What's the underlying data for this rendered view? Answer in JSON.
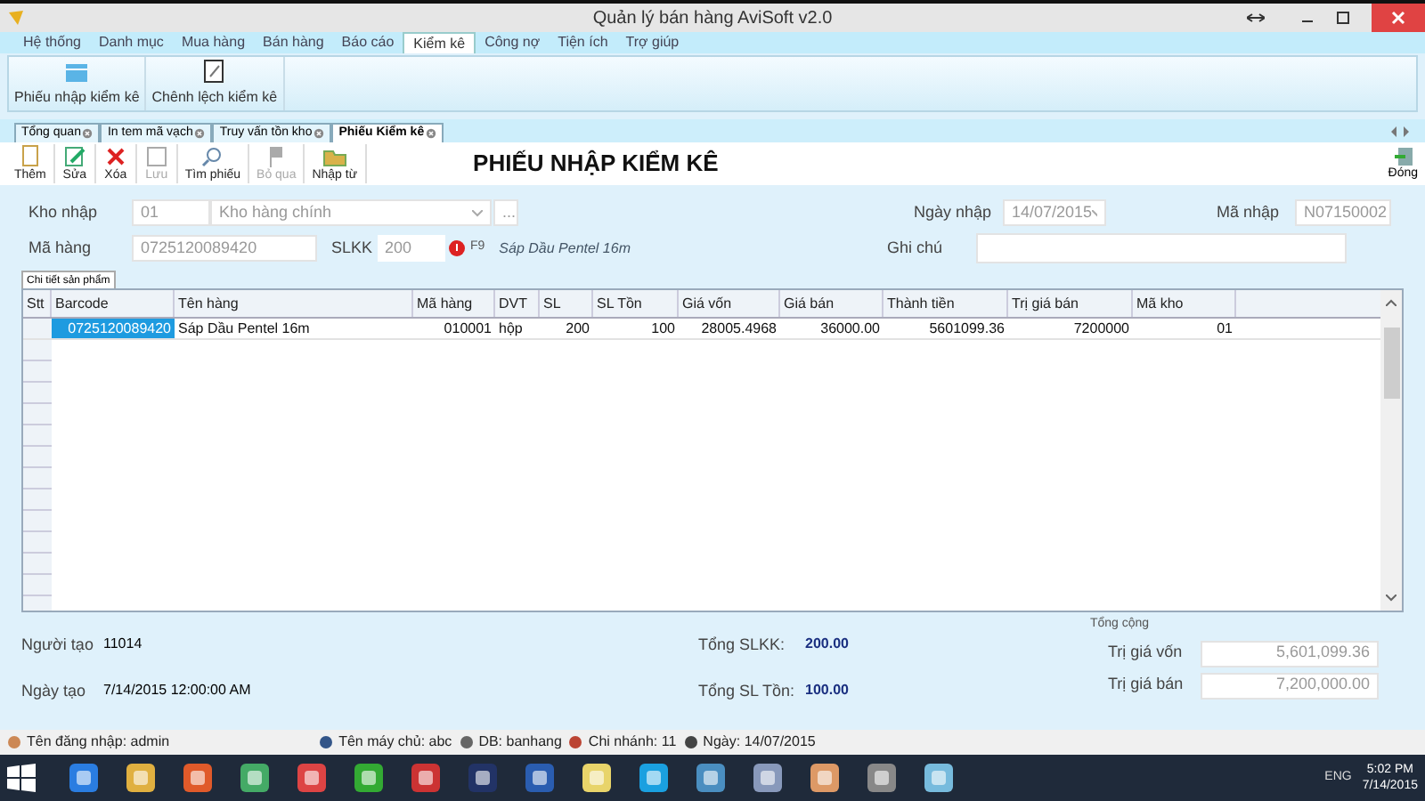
{
  "window": {
    "title": "Quản lý bán hàng AviSoft v2.0"
  },
  "menu": [
    {
      "label": "Hệ thống",
      "selected": false
    },
    {
      "label": "Danh mục",
      "selected": false
    },
    {
      "label": "Mua hàng",
      "selected": false
    },
    {
      "label": "Bán hàng",
      "selected": false
    },
    {
      "label": "Báo cáo",
      "selected": false
    },
    {
      "label": "Kiểm kê",
      "selected": true
    },
    {
      "label": "Công nợ",
      "selected": false
    },
    {
      "label": "Tiện ích",
      "selected": false
    },
    {
      "label": "Trợ giúp",
      "selected": false
    }
  ],
  "ribbon": [
    {
      "label": "Phiếu nhập kiểm kê",
      "kind": "calendar"
    },
    {
      "label": "Chênh lệch kiểm kê",
      "kind": "document"
    }
  ],
  "doc_tabs": [
    {
      "label": "Tổng quan",
      "selected": false
    },
    {
      "label": "In tem mã vạch",
      "selected": false
    },
    {
      "label": "Truy vấn tồn kho",
      "selected": false
    },
    {
      "label": "Phiếu Kiểm kê",
      "selected": true
    }
  ],
  "toolbar": [
    {
      "label": "Thêm",
      "kind": "add",
      "disabled": false
    },
    {
      "label": "Sửa",
      "kind": "edit",
      "disabled": false
    },
    {
      "label": "Xóa",
      "kind": "delete",
      "disabled": false
    },
    {
      "label": "Lưu",
      "kind": "save",
      "disabled": true
    },
    {
      "label": "Tìm phiếu",
      "kind": "search",
      "disabled": false
    },
    {
      "label": "Bỏ qua",
      "kind": "skip",
      "disabled": true
    },
    {
      "label": "Nhập từ",
      "kind": "import",
      "disabled": false
    }
  ],
  "form_title": "PHIẾU NHẬP KIỂM KÊ",
  "close_button": "Đóng",
  "form": {
    "kho_label": "Kho nhập",
    "kho_code": "01",
    "kho_name": "Kho hàng chính",
    "browse": "...",
    "ma_hang_label": "Mã hàng",
    "ma_hang": "0725120089420",
    "slkk_label": "SLKK",
    "slkk": "200",
    "f9": "F9",
    "product_name": "Sáp Dầu Pentel 16m",
    "ngay_label": "Ngày nhập",
    "ngay": "14/07/2015",
    "ma_nhap_label": "Mã nhập",
    "ma_nhap": "N07150002",
    "ghi_chu_label": "Ghi chú"
  },
  "grid_tab": "Chi tiết sản phẩm",
  "table": {
    "columns": [
      "Stt",
      "Barcode",
      "Tên hàng",
      "Mã hàng",
      "DVT",
      "SL",
      "SL Tồn",
      "Giá vốn",
      "Giá bán",
      "Thành tiền",
      "Trị giá bán",
      "Mã kho"
    ],
    "rows": [
      {
        "cells": [
          "",
          "0725120089420",
          "Sáp Dầu Pentel 16m",
          "010001",
          "hộp",
          "200",
          "100",
          "28005.4968",
          "36000.00",
          "5601099.36",
          "7200000",
          "01"
        ],
        "selected": true
      }
    ]
  },
  "footer": {
    "nguoi_tao_label": "Người tạo",
    "nguoi_tao": "11014",
    "ngay_tao_label": "Ngày tạo",
    "ngay_tao": "7/14/2015 12:00:00 AM",
    "tong_slkk_label": "Tổng SLKK:",
    "tong_slkk": "200.00",
    "tong_slton_label": "Tổng SL Tồn:",
    "tong_slton": "100.00",
    "tong_cong": "Tổng cộng",
    "tri_gia_von_label": "Trị giá vốn",
    "tri_gia_von": "5,601,099.36",
    "tri_gia_ban_label": "Trị giá bán",
    "tri_gia_ban": "7,200,000.00"
  },
  "status_bar": [
    {
      "label": "Tên đăng nhập:",
      "value": "admin"
    },
    {
      "label": "Tên máy chủ:",
      "value": "abc"
    },
    {
      "label": "DB:",
      "value": "banhang"
    },
    {
      "label": "Chi nhánh:",
      "value": "11"
    },
    {
      "label": "Ngày:",
      "value": "14/07/2015"
    }
  ],
  "taskbar": {
    "language": "ENG",
    "time": "5:02 PM",
    "date": "7/14/2015"
  }
}
